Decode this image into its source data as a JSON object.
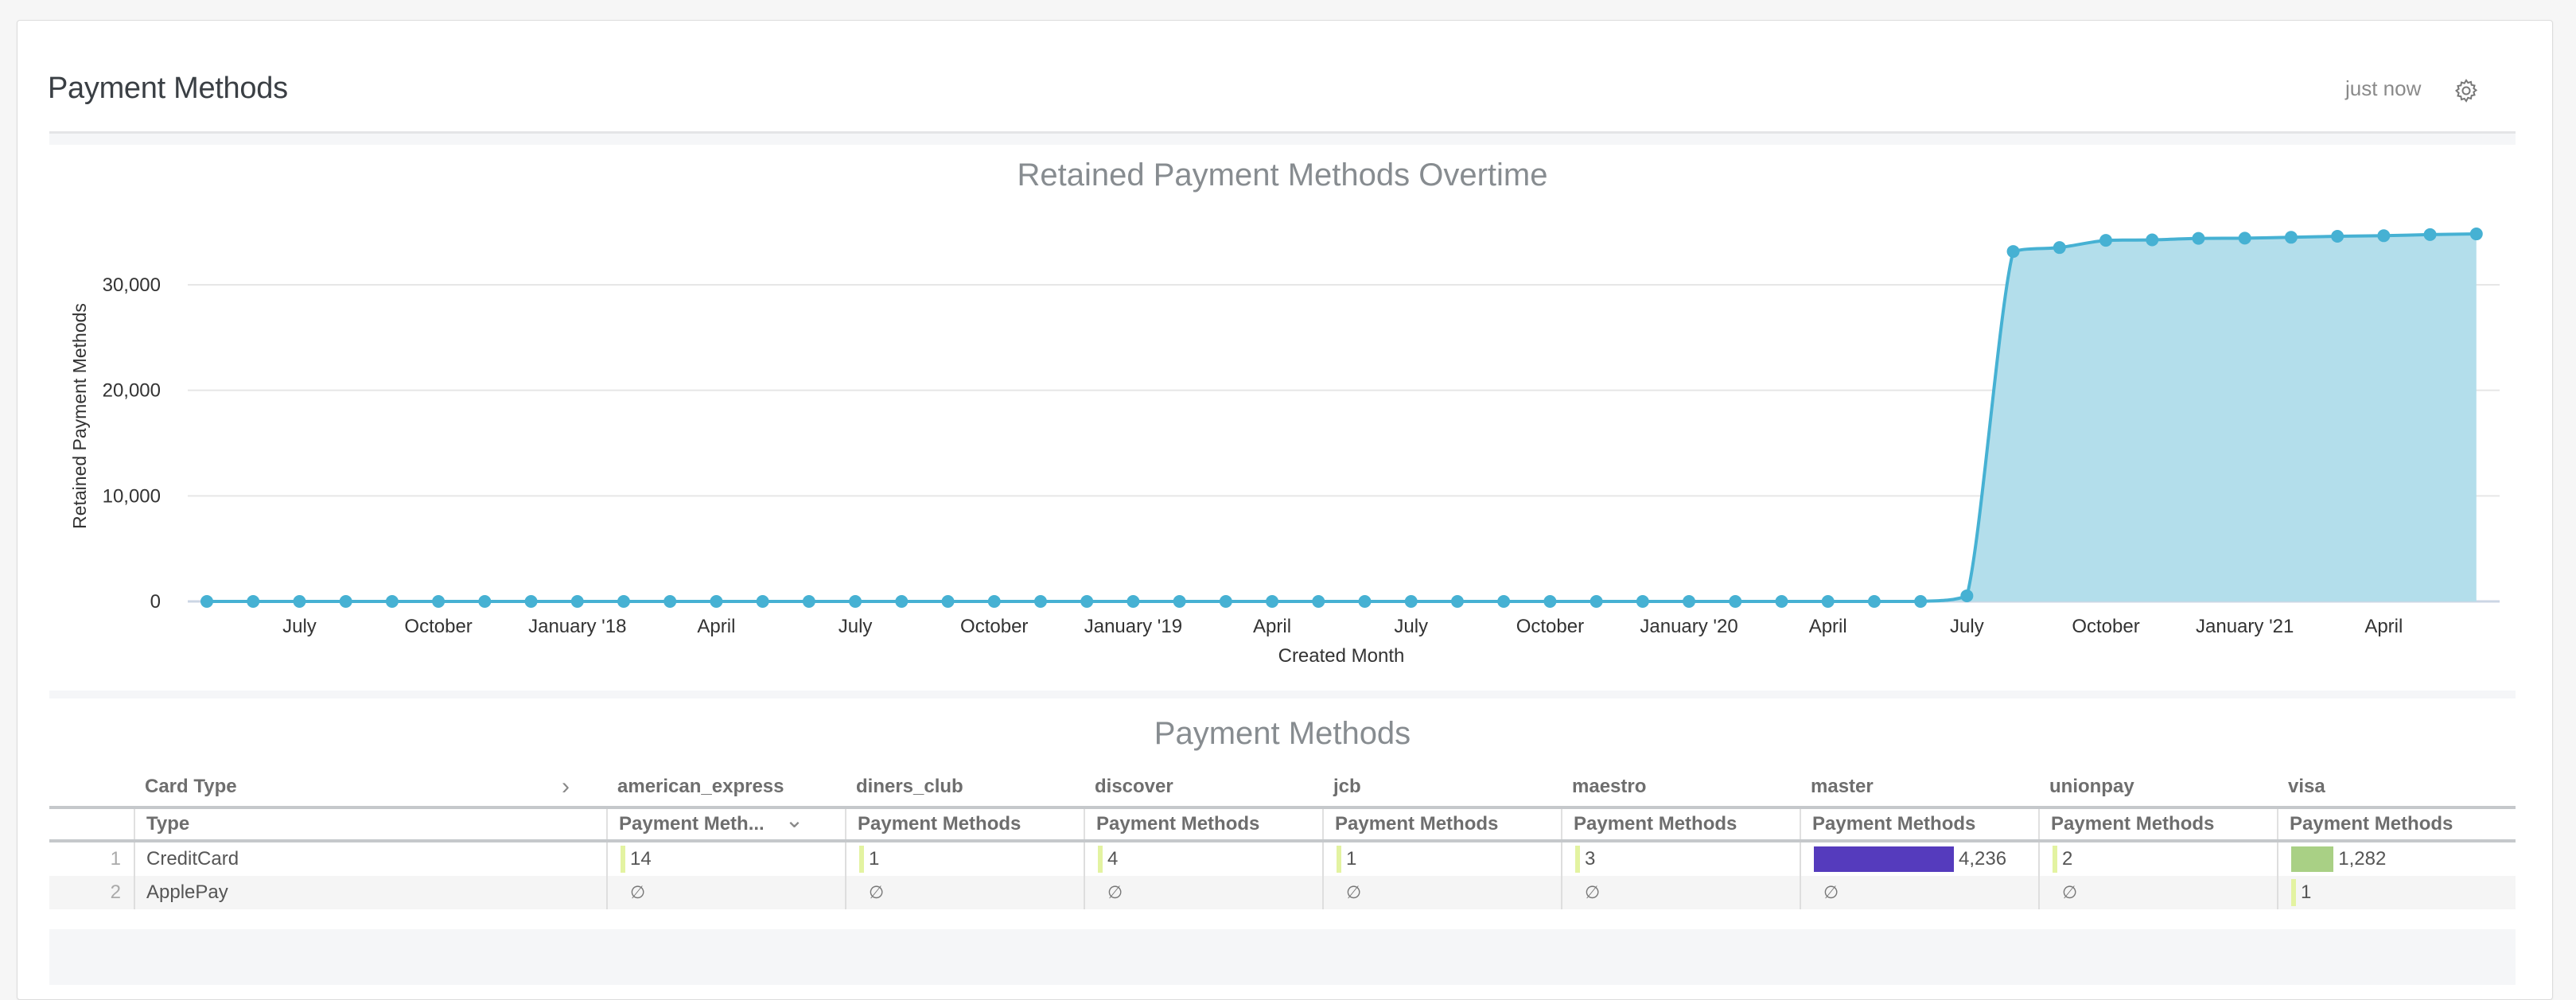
{
  "header": {
    "title": "Payment Methods",
    "updated": "just now",
    "settings_icon": "gear-icon"
  },
  "chart": {
    "title": "Retained Payment Methods Overtime",
    "xlabel": "Created Month",
    "ylabel": "Retained Payment Methods",
    "y_ticks": [
      "0",
      "10,000",
      "20,000",
      "30,000"
    ],
    "x_ticks": [
      "July",
      "October",
      "January '18",
      "April",
      "July",
      "October",
      "January '19",
      "April",
      "July",
      "October",
      "January '20",
      "April",
      "July",
      "October",
      "January '21",
      "April"
    ]
  },
  "chart_data": {
    "type": "area",
    "title": "Retained Payment Methods Overtime",
    "xlabel": "Created Month",
    "ylabel": "Retained Payment Methods",
    "ylim": [
      0,
      35000
    ],
    "y_ticks": [
      0,
      10000,
      20000,
      30000
    ],
    "grid": true,
    "color": "#46b1d3",
    "fill_color": "#b3deeb",
    "x": [
      "2017-05",
      "2017-06",
      "2017-07",
      "2017-08",
      "2017-09",
      "2017-10",
      "2017-11",
      "2017-12",
      "2018-01",
      "2018-02",
      "2018-03",
      "2018-04",
      "2018-05",
      "2018-06",
      "2018-07",
      "2018-08",
      "2018-09",
      "2018-10",
      "2018-11",
      "2018-12",
      "2019-01",
      "2019-02",
      "2019-03",
      "2019-04",
      "2019-05",
      "2019-06",
      "2019-07",
      "2019-08",
      "2019-09",
      "2019-10",
      "2019-11",
      "2019-12",
      "2020-01",
      "2020-02",
      "2020-03",
      "2020-04",
      "2020-05",
      "2020-06",
      "2020-07",
      "2020-08",
      "2020-09",
      "2020-10",
      "2020-11",
      "2020-12",
      "2021-01",
      "2021-02",
      "2021-03",
      "2021-04",
      "2021-05",
      "2021-06"
    ],
    "values": [
      0,
      0,
      0,
      0,
      0,
      0,
      0,
      0,
      0,
      0,
      0,
      0,
      0,
      0,
      0,
      0,
      0,
      0,
      0,
      0,
      0,
      0,
      0,
      0,
      0,
      0,
      0,
      0,
      0,
      0,
      0,
      0,
      0,
      0,
      0,
      0,
      0,
      0,
      530,
      33160,
      33530,
      34210,
      34260,
      34400,
      34420,
      34500,
      34600,
      34650,
      34760,
      34820
    ],
    "x_tick_labels": [
      "July",
      "October",
      "January '18",
      "April",
      "July",
      "October",
      "January '19",
      "April",
      "July",
      "October",
      "January '20",
      "April",
      "July",
      "October",
      "January '21",
      "April"
    ],
    "x_tick_months": [
      "2017-07",
      "2017-10",
      "2018-01",
      "2018-04",
      "2018-07",
      "2018-10",
      "2019-01",
      "2019-04",
      "2019-07",
      "2019-10",
      "2020-01",
      "2020-04",
      "2020-07",
      "2020-10",
      "2021-01",
      "2021-04"
    ]
  },
  "table": {
    "title": "Payment Methods",
    "pivot_header": "Card Type",
    "row_header": "Type",
    "columns": [
      {
        "card": "american_express",
        "measure": "Payment Meth...",
        "sorted": true
      },
      {
        "card": "diners_club",
        "measure": "Payment Methods"
      },
      {
        "card": "discover",
        "measure": "Payment Methods"
      },
      {
        "card": "jcb",
        "measure": "Payment Methods"
      },
      {
        "card": "maestro",
        "measure": "Payment Methods"
      },
      {
        "card": "master",
        "measure": "Payment Methods"
      },
      {
        "card": "unionpay",
        "measure": "Payment Methods"
      },
      {
        "card": "visa",
        "measure": "Payment Methods"
      }
    ],
    "rows": [
      {
        "num": "1",
        "type": "CreditCard",
        "values": [
          "14",
          "1",
          "4",
          "1",
          "3",
          "4,236",
          "2",
          "1,282"
        ],
        "raw": [
          14,
          1,
          4,
          1,
          3,
          4236,
          2,
          1282
        ]
      },
      {
        "num": "2",
        "type": "ApplePay",
        "values": [
          "∅",
          "∅",
          "∅",
          "∅",
          "∅",
          "∅",
          "∅",
          "1"
        ],
        "raw": [
          null,
          null,
          null,
          null,
          null,
          null,
          null,
          1
        ]
      }
    ],
    "bar_colors": {
      "master": "#553bbd",
      "visa": "#a9d085",
      "small": "#e3f3a1"
    }
  }
}
